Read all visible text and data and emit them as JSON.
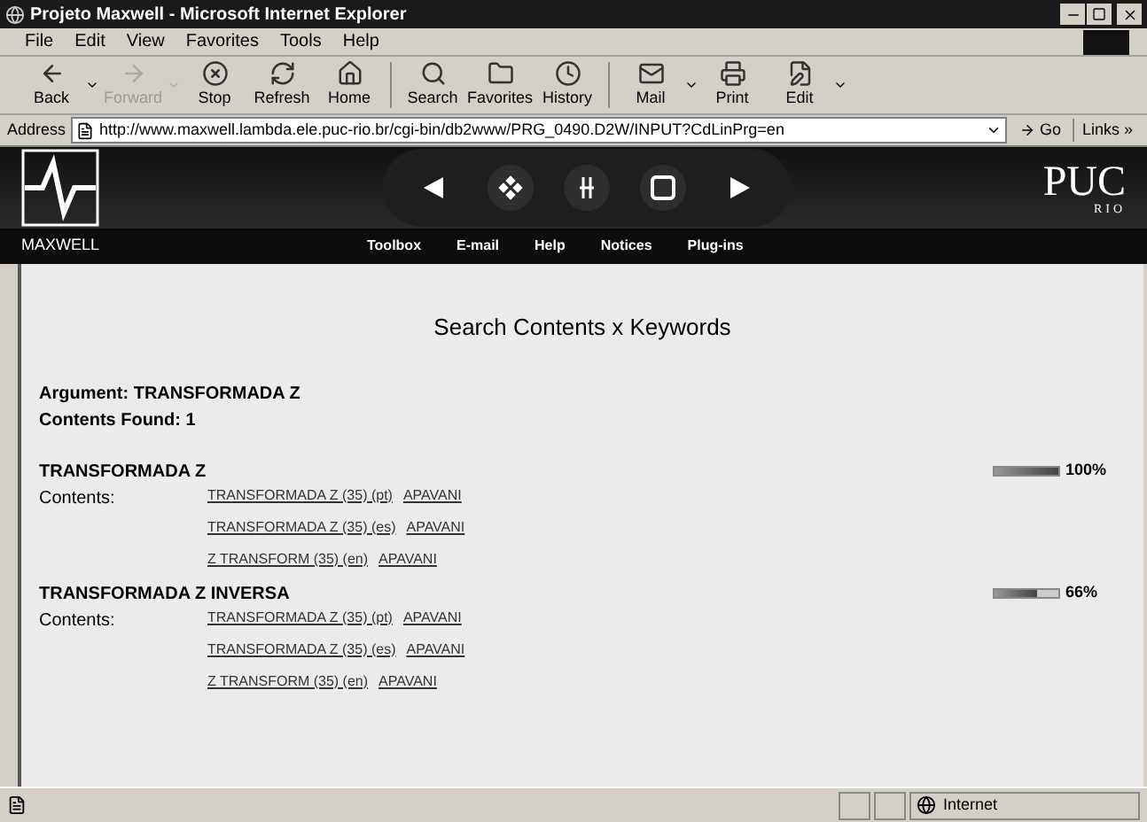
{
  "window": {
    "title": "Projeto Maxwell - Microsoft Internet Explorer"
  },
  "menu": [
    "File",
    "Edit",
    "View",
    "Favorites",
    "Tools",
    "Help"
  ],
  "toolbar": [
    {
      "label": "Back",
      "kind": "back",
      "disabled": false,
      "dropdown": true
    },
    {
      "label": "Forward",
      "kind": "forward",
      "disabled": true,
      "dropdown": true
    },
    {
      "label": "Stop",
      "kind": "stop",
      "disabled": false,
      "dropdown": false
    },
    {
      "label": "Refresh",
      "kind": "refresh",
      "disabled": false,
      "dropdown": false
    },
    {
      "label": "Home",
      "kind": "home",
      "disabled": false,
      "dropdown": false
    },
    {
      "label": "Search",
      "kind": "search",
      "disabled": false,
      "dropdown": false,
      "group_start": true
    },
    {
      "label": "Favorites",
      "kind": "favorites",
      "disabled": false,
      "dropdown": false
    },
    {
      "label": "History",
      "kind": "history",
      "disabled": false,
      "dropdown": false
    },
    {
      "label": "Mail",
      "kind": "mail",
      "disabled": false,
      "dropdown": true,
      "group_start": true
    },
    {
      "label": "Print",
      "kind": "print",
      "disabled": false,
      "dropdown": false
    },
    {
      "label": "Edit",
      "kind": "edit",
      "disabled": false,
      "dropdown": true
    }
  ],
  "address": {
    "label": "Address",
    "url": "http://www.maxwell.lambda.ele.puc-rio.br/cgi-bin/db2www/PRG_0490.D2W/INPUT?CdLinPrg=en",
    "go": "Go",
    "links": "Links »"
  },
  "banner": {
    "brand": "MAXWELL",
    "logo": "PUC",
    "logo_sub": "RIO",
    "nav": [
      "Toolbox",
      "E-mail",
      "Help",
      "Notices",
      "Plug-ins"
    ]
  },
  "content": {
    "heading": "Search Contents x Keywords",
    "argument": "Argument: TRANSFORMADA Z",
    "found": "Contents Found: 1",
    "results": [
      {
        "title": "TRANSFORMADA Z",
        "level": 1,
        "percent": "100%",
        "contents_label": "Contents:",
        "links": [
          {
            "title": "TRANSFORMADA Z (35) (pt)",
            "author": "APAVANI"
          },
          {
            "title": "TRANSFORMADA Z (35) (es)",
            "author": "APAVANI"
          },
          {
            "title": "Z TRANSFORM (35) (en)",
            "author": "APAVANI"
          }
        ]
      },
      {
        "title": "TRANSFORMADA Z INVERSA",
        "level": 0.66,
        "percent": "66%",
        "contents_label": "Contents:",
        "links": [
          {
            "title": "TRANSFORMADA Z (35) (pt)",
            "author": "APAVANI"
          },
          {
            "title": "TRANSFORMADA Z (35) (es)",
            "author": "APAVANI"
          },
          {
            "title": "Z TRANSFORM (35) (en)",
            "author": "APAVANI"
          }
        ]
      }
    ]
  },
  "status_bar": {
    "zone": "Internet"
  }
}
